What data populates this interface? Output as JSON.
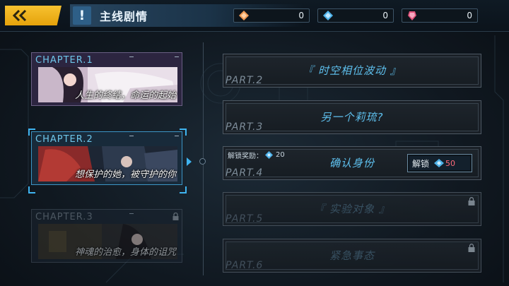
{
  "header": {
    "title": "主线剧情",
    "title_mark": "!",
    "currencies": [
      {
        "icon": "orange-ticket-icon",
        "value": "0",
        "color": "#f09a55"
      },
      {
        "icon": "blue-crystal-icon",
        "value": "0",
        "color": "#4fb3ea"
      },
      {
        "icon": "pink-gem-icon",
        "value": "0",
        "color": "#e0527a"
      }
    ]
  },
  "chapters": [
    {
      "label": "CHAPTER.1",
      "subtitle": "人生的终结，命运的起始",
      "state": "unlocked"
    },
    {
      "label": "CHAPTER.2",
      "subtitle": "想保护的她，被守护的你",
      "state": "selected"
    },
    {
      "label": "CHAPTER.3",
      "subtitle": "神魂的治愈，身体的诅咒",
      "state": "locked"
    }
  ],
  "parts": [
    {
      "num": "PART.2",
      "title": "『 时空相位波动 』",
      "state": "unlocked"
    },
    {
      "num": "PART.3",
      "title": "另一个莉琉?",
      "state": "unlocked"
    },
    {
      "num": "PART.4",
      "title": "确认身份",
      "state": "unlockable",
      "reward_label": "解锁奖励：",
      "reward_value": "20",
      "unlock_label": "解锁",
      "unlock_cost": "50"
    },
    {
      "num": "PART.5",
      "title": "『 实验对象 』",
      "state": "locked"
    },
    {
      "num": "PART.6",
      "title": "紧急事态",
      "state": "locked"
    }
  ],
  "colors": {
    "accent": "#3fb4f0",
    "back_button": "#f2b520",
    "cost": "#ff6a7a"
  }
}
